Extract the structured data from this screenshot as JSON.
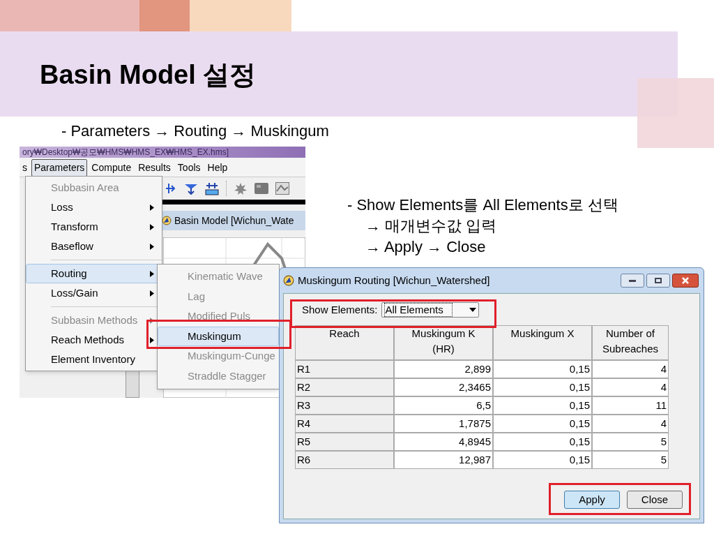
{
  "slide": {
    "title": "Basin Model 설정",
    "subtitle": "- Parameters → Routing → Muskingum",
    "notes": [
      "- Show Elements를 All Elements로 선택",
      "→ 매개변수값 입력",
      "→ Apply → Close"
    ]
  },
  "hms_window": {
    "title": "ory₩Desktop₩공모₩HMS₩HMS_EX₩HMS_EX.hms]",
    "menu": [
      {
        "label": "s",
        "selected": false
      },
      {
        "label": "Parameters",
        "selected": true
      },
      {
        "label": "Compute",
        "selected": false
      },
      {
        "label": "Results",
        "selected": false
      },
      {
        "label": "Tools",
        "selected": false
      },
      {
        "label": "Help",
        "selected": false
      }
    ],
    "parameters_menu": [
      {
        "label": "Subbasin Area",
        "disabled": true,
        "selected": false,
        "submenu": false,
        "divider_before": false
      },
      {
        "label": "Loss",
        "disabled": false,
        "selected": false,
        "submenu": true,
        "divider_before": false
      },
      {
        "label": "Transform",
        "disabled": false,
        "selected": false,
        "submenu": true,
        "divider_before": false
      },
      {
        "label": "Baseflow",
        "disabled": false,
        "selected": false,
        "submenu": true,
        "divider_before": false
      },
      {
        "label": "Routing",
        "disabled": false,
        "selected": true,
        "submenu": true,
        "divider_before": true
      },
      {
        "label": "Loss/Gain",
        "disabled": false,
        "selected": false,
        "submenu": true,
        "divider_before": false
      },
      {
        "label": "Subbasin Methods",
        "disabled": true,
        "selected": false,
        "submenu": true,
        "divider_before": true
      },
      {
        "label": "Reach Methods",
        "disabled": false,
        "selected": false,
        "submenu": true,
        "divider_before": false
      },
      {
        "label": "Element Inventory",
        "disabled": false,
        "selected": false,
        "submenu": false,
        "divider_before": false
      }
    ],
    "routing_submenu": [
      {
        "label": "Kinematic Wave",
        "disabled": true,
        "selected": false
      },
      {
        "label": "Lag",
        "disabled": true,
        "selected": false
      },
      {
        "label": "Modified Puls",
        "disabled": true,
        "selected": false
      },
      {
        "label": "Muskingum",
        "disabled": false,
        "selected": true
      },
      {
        "label": "Muskingum-Cunge",
        "disabled": true,
        "selected": false
      },
      {
        "label": "Straddle Stagger",
        "disabled": true,
        "selected": false
      }
    ],
    "basin_window_title": "Basin Model [Wichun_Wate"
  },
  "dialog": {
    "title": "Muskingum Routing [Wichun_Watershed]",
    "show_elements_label": "Show Elements:",
    "show_elements_value": "All Elements",
    "table": {
      "columns": [
        "Reach",
        "Muskingum K\n(HR)",
        "Muskingum X",
        "Number of\nSubreaches"
      ],
      "rows": [
        [
          "R1",
          "2,899",
          "0,15",
          "4"
        ],
        [
          "R2",
          "2,3465",
          "0,15",
          "4"
        ],
        [
          "R3",
          "6,5",
          "0,15",
          "11"
        ],
        [
          "R4",
          "1,7875",
          "0,15",
          "4"
        ],
        [
          "R5",
          "4,8945",
          "0,15",
          "5"
        ],
        [
          "R6",
          "12,987",
          "0,15",
          "5"
        ]
      ]
    },
    "buttons": [
      "Apply",
      "Close"
    ]
  }
}
